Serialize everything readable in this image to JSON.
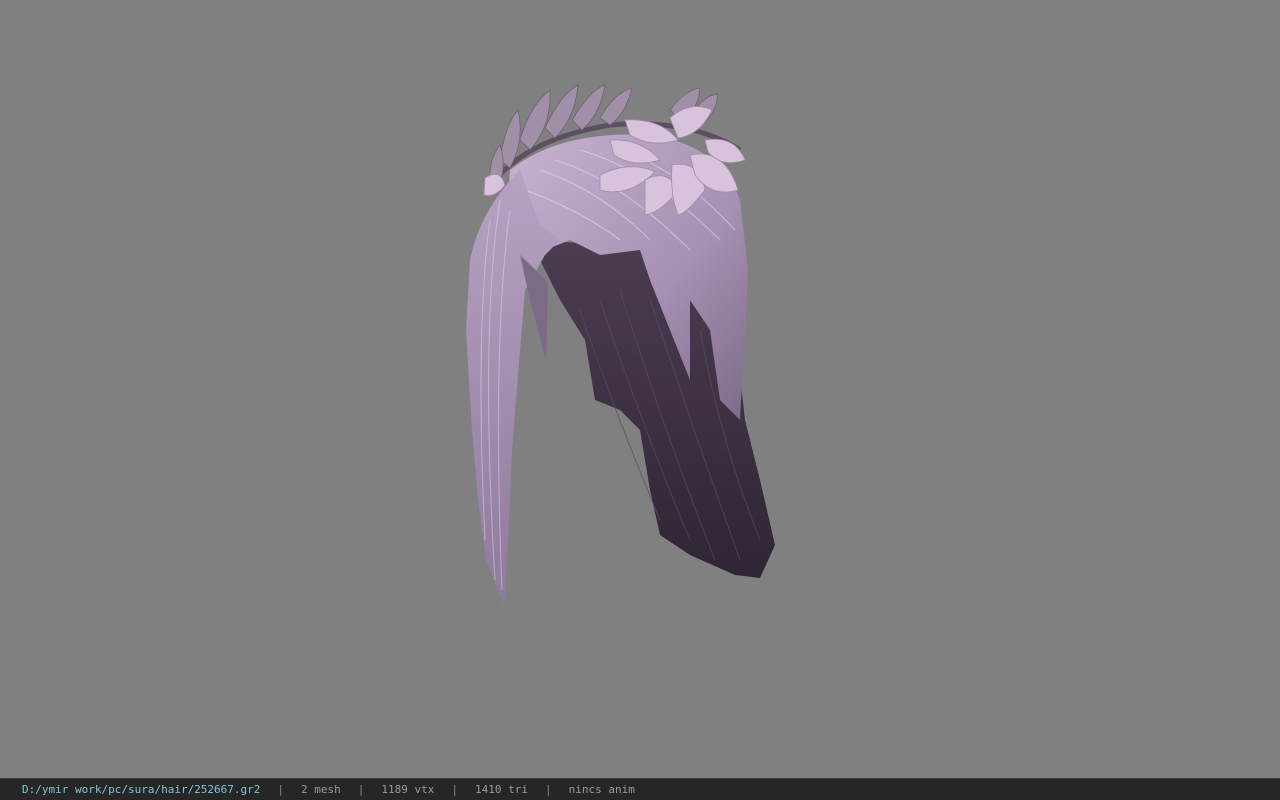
{
  "viewer": {
    "background_color": "#808080",
    "model": {
      "subject": "hair-with-leaf-crown",
      "hair_light_color": "#b9a3c5",
      "hair_dark_color": "#3f3345",
      "leaf_color": "#d8bfd8"
    }
  },
  "statusbar": {
    "file_path": "D:/ymir work/pc/sura/hair/252667.gr2",
    "mesh": "2 mesh",
    "vertices": "1189 vtx",
    "triangles": "1410 tri",
    "anim": "nincs anim",
    "separator": "|"
  }
}
